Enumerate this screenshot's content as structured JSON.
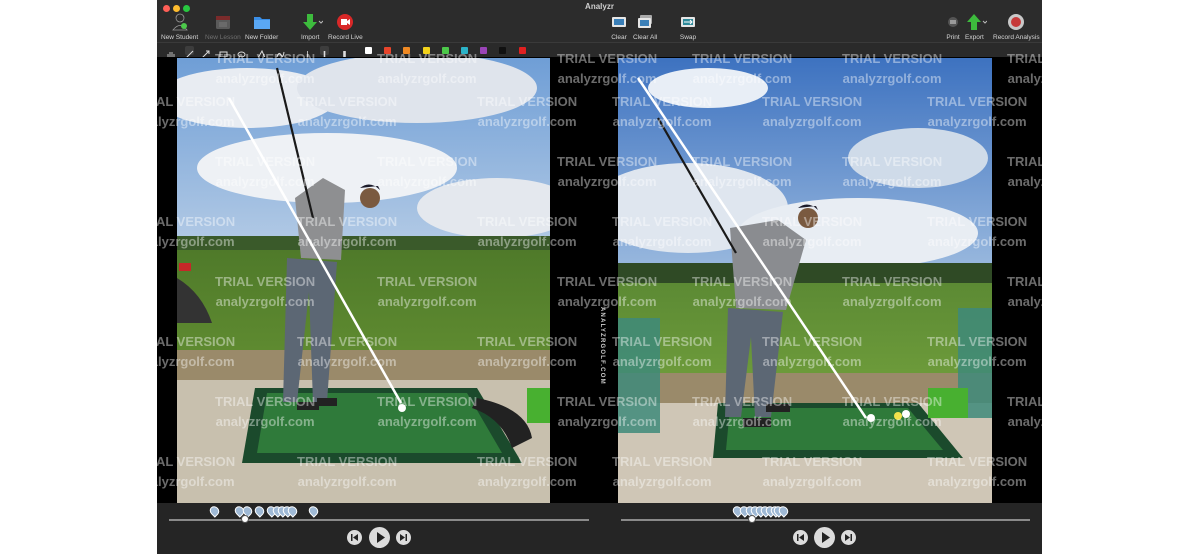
{
  "window": {
    "title": "Analyzr"
  },
  "toolbar": {
    "new_student": "New Student",
    "new_lesson": "New Lesson",
    "new_folder": "New Folder",
    "import": "Import",
    "record_live": "Record Live",
    "clear": "Clear",
    "clear_all": "Clear All",
    "swap": "Swap",
    "print": "Print",
    "export": "Export",
    "record_analysis": "Record Analysis"
  },
  "drawing_tools": [
    "hand-tool",
    "line-tool",
    "arrow-tool",
    "rectangle-tool",
    "ellipse-tool",
    "angle-tool",
    "freehand-tool",
    "thin-line",
    "medium-line",
    "thick-line"
  ],
  "colors": [
    "#ffffff",
    "#e8452c",
    "#f08a24",
    "#f2d21b",
    "#4cc84a",
    "#2bb3c8",
    "#9a44b8",
    "#111111",
    "#e02020"
  ],
  "watermark": {
    "line1": "TRIAL VERSION",
    "line2": "analyzrgolf.com"
  },
  "divider_text": "ANALYZRGOLF.COM",
  "left_timeline": {
    "markers": [
      "1",
      "2",
      "3",
      "4",
      "5",
      "6",
      "7",
      "8",
      "9",
      "10"
    ],
    "playhead_fraction": 0.18
  },
  "right_timeline": {
    "markers": [
      "1",
      "2",
      "3",
      "4",
      "5",
      "6",
      "7",
      "8",
      "9",
      "10"
    ],
    "playhead_fraction": 0.32
  },
  "playback": [
    "previous-frame",
    "play",
    "next-frame"
  ]
}
